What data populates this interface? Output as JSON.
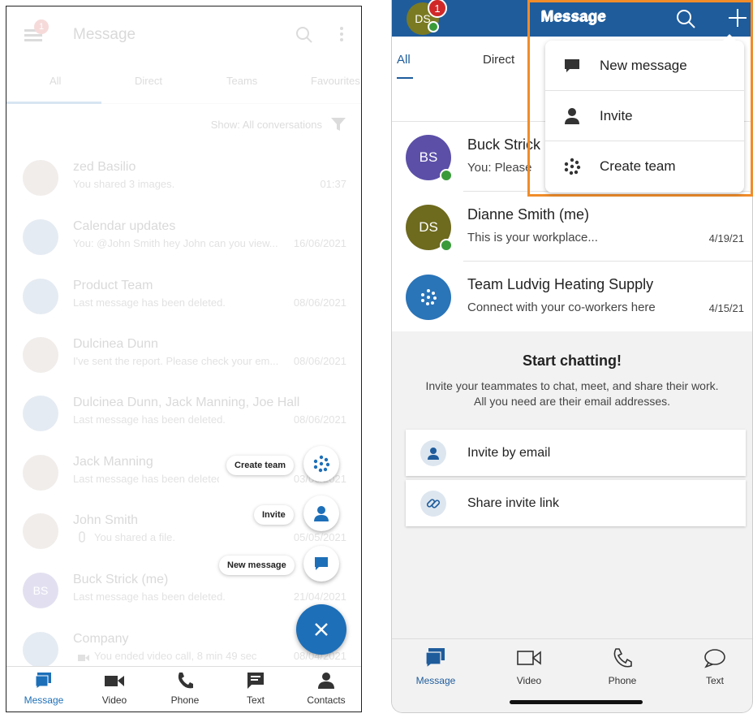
{
  "left": {
    "header": {
      "title": "Message",
      "badge": "1"
    },
    "tabs": [
      "All",
      "Direct",
      "Teams",
      "Favourites"
    ],
    "filter": {
      "label": "Show: All conversations"
    },
    "conversations": [
      {
        "name": "zed Basilio",
        "sub": "You shared 3 images.",
        "time": "01:37"
      },
      {
        "name": "Calendar updates",
        "sub": "You: @John Smith hey John can you view...",
        "time": "16/06/2021"
      },
      {
        "name": "Product Team",
        "sub": "Last message has been deleted.",
        "time": "08/06/2021"
      },
      {
        "name": "Dulcinea Dunn",
        "sub": "I've sent the report. Please check your em...",
        "time": "08/06/2021"
      },
      {
        "name": "Dulcinea Dunn, Jack Manning, Joe Hall",
        "sub": "Last message has been deleted.",
        "time": "08/06/2021"
      },
      {
        "name": "Jack Manning",
        "sub": "Last message has been deleted.",
        "time": "03/06/2021"
      },
      {
        "name": "John Smith",
        "sub": "You shared a file.",
        "time": "05/05/2021"
      },
      {
        "name": "Buck Strick (me)",
        "sub": "Last message has been deleted.",
        "time": "21/04/2021",
        "initials": "BS"
      },
      {
        "name": "Company",
        "sub": "You ended video call, 8 min 49 sec",
        "time": "08/04/2021"
      }
    ],
    "fab": {
      "create_team": "Create team",
      "invite": "Invite",
      "new_message": "New message"
    },
    "nav": [
      "Message",
      "Video",
      "Phone",
      "Text",
      "Contacts"
    ]
  },
  "right": {
    "header": {
      "title": "Message",
      "avatar": "DS",
      "badge": "1"
    },
    "tabs": [
      "All",
      "Direct"
    ],
    "dropdown": {
      "title": "Message",
      "items": [
        "New message",
        "Invite",
        "Create team"
      ]
    },
    "conversations": [
      {
        "initials": "BS",
        "name": "Buck Strick",
        "sub": "You: Please",
        "time": ""
      },
      {
        "initials": "DS",
        "name": "Dianne Smith (me)",
        "sub": "This is your workplace...",
        "time": "4/19/21"
      },
      {
        "initials": "",
        "name": "Team Ludvig Heating Supply",
        "sub": "Connect with your co-workers here",
        "time": "4/15/21"
      }
    ],
    "start": {
      "title": "Start chatting!",
      "desc_line1": "Invite your teammates to chat, meet, and share their work.",
      "desc_line2": "All you need are their email addresses."
    },
    "cards": [
      "Invite by email",
      "Share invite link"
    ],
    "nav": [
      "Message",
      "Video",
      "Phone",
      "Text"
    ]
  },
  "colors": {
    "primary": "#1e5c9c",
    "android_primary": "#1d6fb8",
    "highlight": "#f08c2a",
    "online": "#3a9a3a",
    "badge": "#d02828"
  }
}
